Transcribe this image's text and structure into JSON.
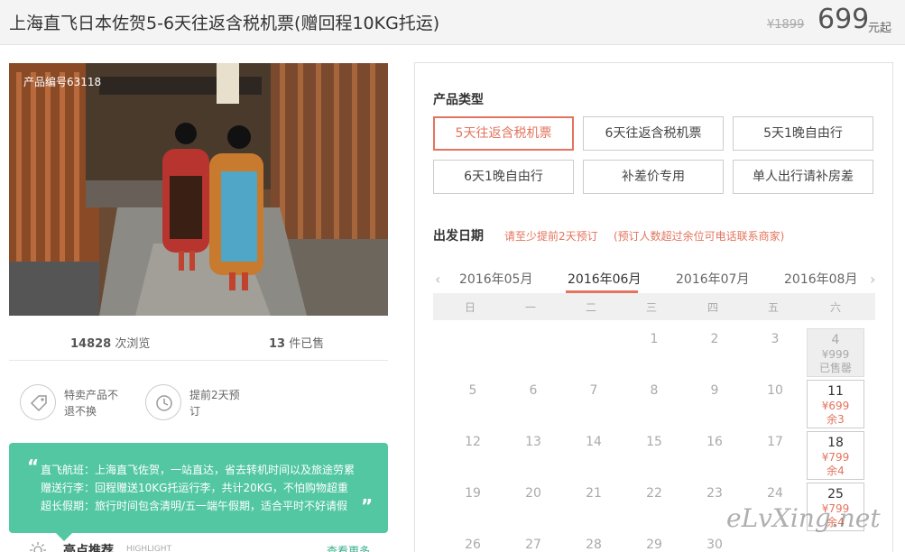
{
  "header": {
    "title": "上海直飞日本佐贺5-6天往返含税机票(赠回程10KG托运)",
    "old_price": "¥1899",
    "price": "699",
    "price_unit": "元起"
  },
  "gallery": {
    "product_code": "产品编号63118"
  },
  "stats": {
    "views_count": "14828",
    "views_label": "次浏览",
    "sold_count": "13",
    "sold_label": "件已售"
  },
  "features": [
    {
      "icon": "tag-icon",
      "text": "特卖产品不退不换"
    },
    {
      "icon": "history-clock-icon",
      "text": "提前2天预订"
    }
  ],
  "promo": {
    "lines": [
      "直飞航班：上海直飞佐贺，一站直达，省去转机时间以及旅途劳累",
      "赠送行李：回程赠送10KG托运行李，共计20KG，不怕购物超重",
      "超长假期：旅行时间包含清明/五一端午假期，适合平时不好请假"
    ]
  },
  "highlights": {
    "title": "亮点推荐",
    "subtitle": "HIGHLIGHT",
    "more": "查看更多"
  },
  "product_type": {
    "label": "产品类型",
    "options": [
      {
        "label": "5天往返含税机票",
        "selected": true
      },
      {
        "label": "6天往返含税机票",
        "selected": false
      },
      {
        "label": "5天1晚自由行",
        "selected": false
      },
      {
        "label": "6天1晚自由行",
        "selected": false
      },
      {
        "label": "补差价专用",
        "selected": false
      },
      {
        "label": "单人出行请补房差",
        "selected": false
      }
    ]
  },
  "departure": {
    "label": "出发日期",
    "note1": "请至少提前2天预订",
    "note2": "(预订人数超过余位可电话联系商家)",
    "months": [
      "2016年05月",
      "2016年06月",
      "2016年07月",
      "2016年08月"
    ],
    "active_month": "2016年06月",
    "weekdays": [
      "日",
      "一",
      "二",
      "三",
      "四",
      "五",
      "六"
    ],
    "days": {
      "r0": [
        "1",
        "2",
        "3"
      ],
      "r1": [
        "5",
        "6",
        "7",
        "8",
        "9",
        "10"
      ],
      "r2": [
        "12",
        "13",
        "14",
        "15",
        "16",
        "17"
      ],
      "r3": [
        "19",
        "20",
        "21",
        "22",
        "23",
        "24"
      ],
      "r4": [
        "26",
        "27",
        "28",
        "29",
        "30"
      ]
    },
    "cells": [
      {
        "day": "4",
        "price": "¥999",
        "remain": "已售罄",
        "status": "soldout"
      },
      {
        "day": "11",
        "price": "¥699",
        "remain": "余3",
        "status": "available"
      },
      {
        "day": "18",
        "price": "¥799",
        "remain": "余4",
        "status": "available"
      },
      {
        "day": "25",
        "price": "¥799",
        "remain": "余4",
        "status": "available"
      }
    ]
  },
  "watermark": "eLvXing.net",
  "colors": {
    "accent": "#e3745e",
    "promo_bg": "#52c7a2",
    "green_link": "#3cae8a"
  }
}
